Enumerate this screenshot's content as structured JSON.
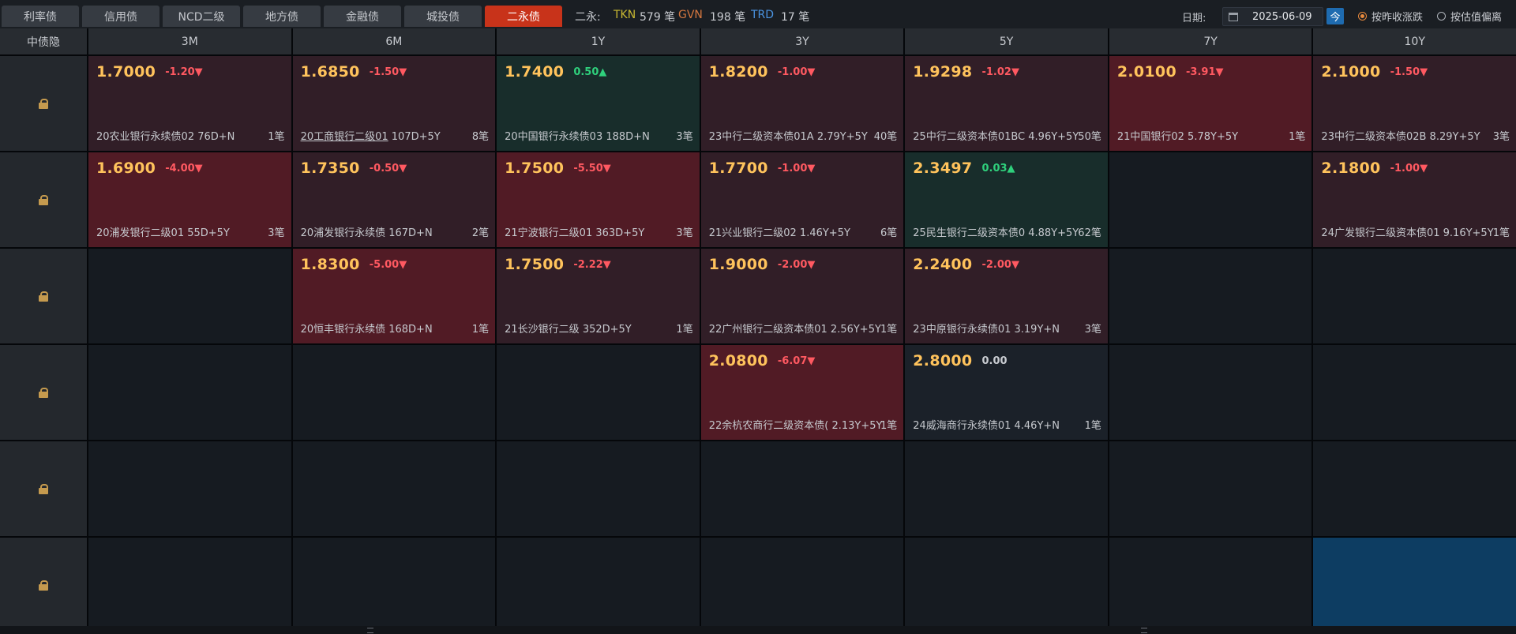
{
  "tabs": [
    {
      "label": "利率债",
      "active": false
    },
    {
      "label": "信用债",
      "active": false
    },
    {
      "label": "NCD二级",
      "active": false
    },
    {
      "label": "地方债",
      "active": false
    },
    {
      "label": "金融债",
      "active": false
    },
    {
      "label": "城投债",
      "active": false
    },
    {
      "label": "二永债",
      "active": true
    }
  ],
  "stats": {
    "prefix": "二永:",
    "tkn_key": "TKN",
    "tkn_val": "579 笔",
    "gvn_key": "GVN",
    "gvn_val": "198 笔",
    "trd_key": "TRD",
    "trd_val": "17 笔"
  },
  "date": {
    "label": "日期:",
    "value": "2025-06-09",
    "today": "今"
  },
  "radios": [
    {
      "label": "按昨收涨跌",
      "selected": true
    },
    {
      "label": "按估值偏离",
      "selected": false
    }
  ],
  "grid": {
    "corner": "中债隐",
    "columns": [
      "3M",
      "6M",
      "1Y",
      "3Y",
      "5Y",
      "7Y",
      "10Y"
    ],
    "rows": [
      [
        {
          "price": "1.7000",
          "change": "-1.20▼",
          "dir": "down",
          "bond": "20农业银行永续债02 76D+N",
          "count": "1笔",
          "bg": "dm"
        },
        {
          "price": "1.6850",
          "change": "-1.50▼",
          "dir": "down",
          "bond_link": "20工商银行二级01",
          "bond": " 107D+5Y",
          "count": "8笔",
          "bg": "dm"
        },
        {
          "price": "1.7400",
          "change": "0.50▲",
          "dir": "up",
          "bond": "20中国银行永续债03 188D+N",
          "count": "3笔",
          "bg": "gr"
        },
        {
          "price": "1.8200",
          "change": "-1.00▼",
          "dir": "down",
          "bond": "23中行二级资本债01A 2.79Y+5Y",
          "count": "40笔",
          "bg": "dm"
        },
        {
          "price": "1.9298",
          "change": "-1.02▼",
          "dir": "down",
          "bond": "25中行二级资本债01BC 4.96Y+5Y",
          "count": "50笔",
          "bg": "dm"
        },
        {
          "price": "2.0100",
          "change": "-3.91▼",
          "dir": "down",
          "bond": "21中国银行02 5.78Y+5Y",
          "count": "1笔",
          "bg": "rd"
        },
        {
          "price": "2.1000",
          "change": "-1.50▼",
          "dir": "down",
          "bond": "23中行二级资本债02B 8.29Y+5Y",
          "count": "3笔",
          "bg": "dm"
        }
      ],
      [
        {
          "price": "1.6900",
          "change": "-4.00▼",
          "dir": "down",
          "bond": "20浦发银行二级01 55D+5Y",
          "count": "3笔",
          "bg": "rd"
        },
        {
          "price": "1.7350",
          "change": "-0.50▼",
          "dir": "down",
          "bond": "20浦发银行永续债 167D+N",
          "count": "2笔",
          "bg": "dm"
        },
        {
          "price": "1.7500",
          "change": "-5.50▼",
          "dir": "down",
          "bond": "21宁波银行二级01 363D+5Y",
          "count": "3笔",
          "bg": "rd"
        },
        {
          "price": "1.7700",
          "change": "-1.00▼",
          "dir": "down",
          "bond": "21兴业银行二级02 1.46Y+5Y",
          "count": "6笔",
          "bg": "dm"
        },
        {
          "price": "2.3497",
          "change": "0.03▲",
          "dir": "up",
          "bond": "25民生银行二级资本债0 4.88Y+5Y",
          "count": "62笔",
          "bg": "gr"
        },
        null,
        {
          "price": "2.1800",
          "change": "-1.00▼",
          "dir": "down",
          "bond": "24广发银行二级资本债01 9.16Y+5Y",
          "count": "1笔",
          "bg": "dm"
        }
      ],
      [
        null,
        {
          "price": "1.8300",
          "change": "-5.00▼",
          "dir": "down",
          "bond": "20恒丰银行永续债 168D+N",
          "count": "1笔",
          "bg": "rd"
        },
        {
          "price": "1.7500",
          "change": "-2.22▼",
          "dir": "down",
          "bond": "21长沙银行二级 352D+5Y",
          "count": "1笔",
          "bg": "dm"
        },
        {
          "price": "1.9000",
          "change": "-2.00▼",
          "dir": "down",
          "bond": "22广州银行二级资本债01 2.56Y+5Y",
          "count": "1笔",
          "bg": "dm"
        },
        {
          "price": "2.2400",
          "change": "-2.00▼",
          "dir": "down",
          "bond": "23中原银行永续债01 3.19Y+N",
          "count": "3笔",
          "bg": "dm"
        },
        null,
        null
      ],
      [
        null,
        null,
        null,
        {
          "price": "2.0800",
          "change": "-6.07▼",
          "dir": "down",
          "bond": "22余杭农商行二级资本债( 2.13Y+5Y",
          "count": "1笔",
          "bg": "rd"
        },
        {
          "price": "2.8000",
          "change": "0.00",
          "dir": "flat",
          "bond": "24威海商行永续债01 4.46Y+N",
          "count": "1笔",
          "bg": "nt"
        },
        null,
        null
      ],
      [
        null,
        null,
        null,
        null,
        null,
        null,
        null
      ],
      [
        null,
        null,
        null,
        null,
        null,
        null,
        "selected"
      ]
    ]
  }
}
